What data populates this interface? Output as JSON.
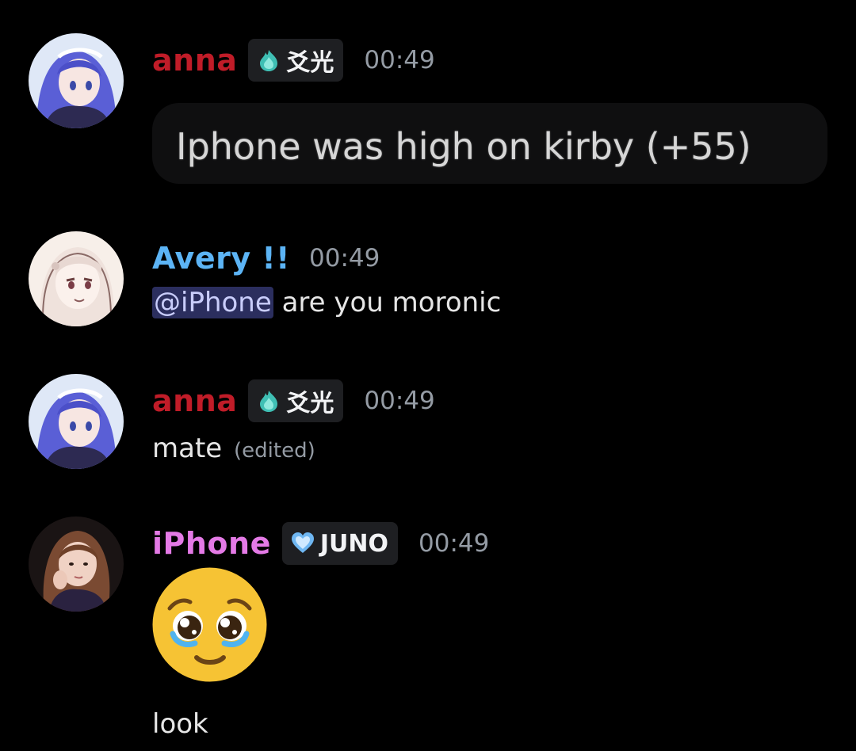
{
  "messages": [
    {
      "user": "anna",
      "user_color": "#c01c28",
      "tag": "爻光",
      "time": "00:49",
      "quoted_text": "Iphone was high on kirby (+55)"
    },
    {
      "user": "Avery !!",
      "user_color": "#5cb4f5",
      "time": "00:49",
      "mention": "@iPhone",
      "text": " are you moronic"
    },
    {
      "user": "anna",
      "user_color": "#c01c28",
      "tag": "爻光",
      "time": "00:49",
      "text": "mate",
      "edited": "(edited)"
    },
    {
      "user": "iPhone",
      "user_color": "#e47ae6",
      "tag": "JUNO",
      "time": "00:49",
      "emoji": "pleading-face",
      "text": "look"
    }
  ]
}
